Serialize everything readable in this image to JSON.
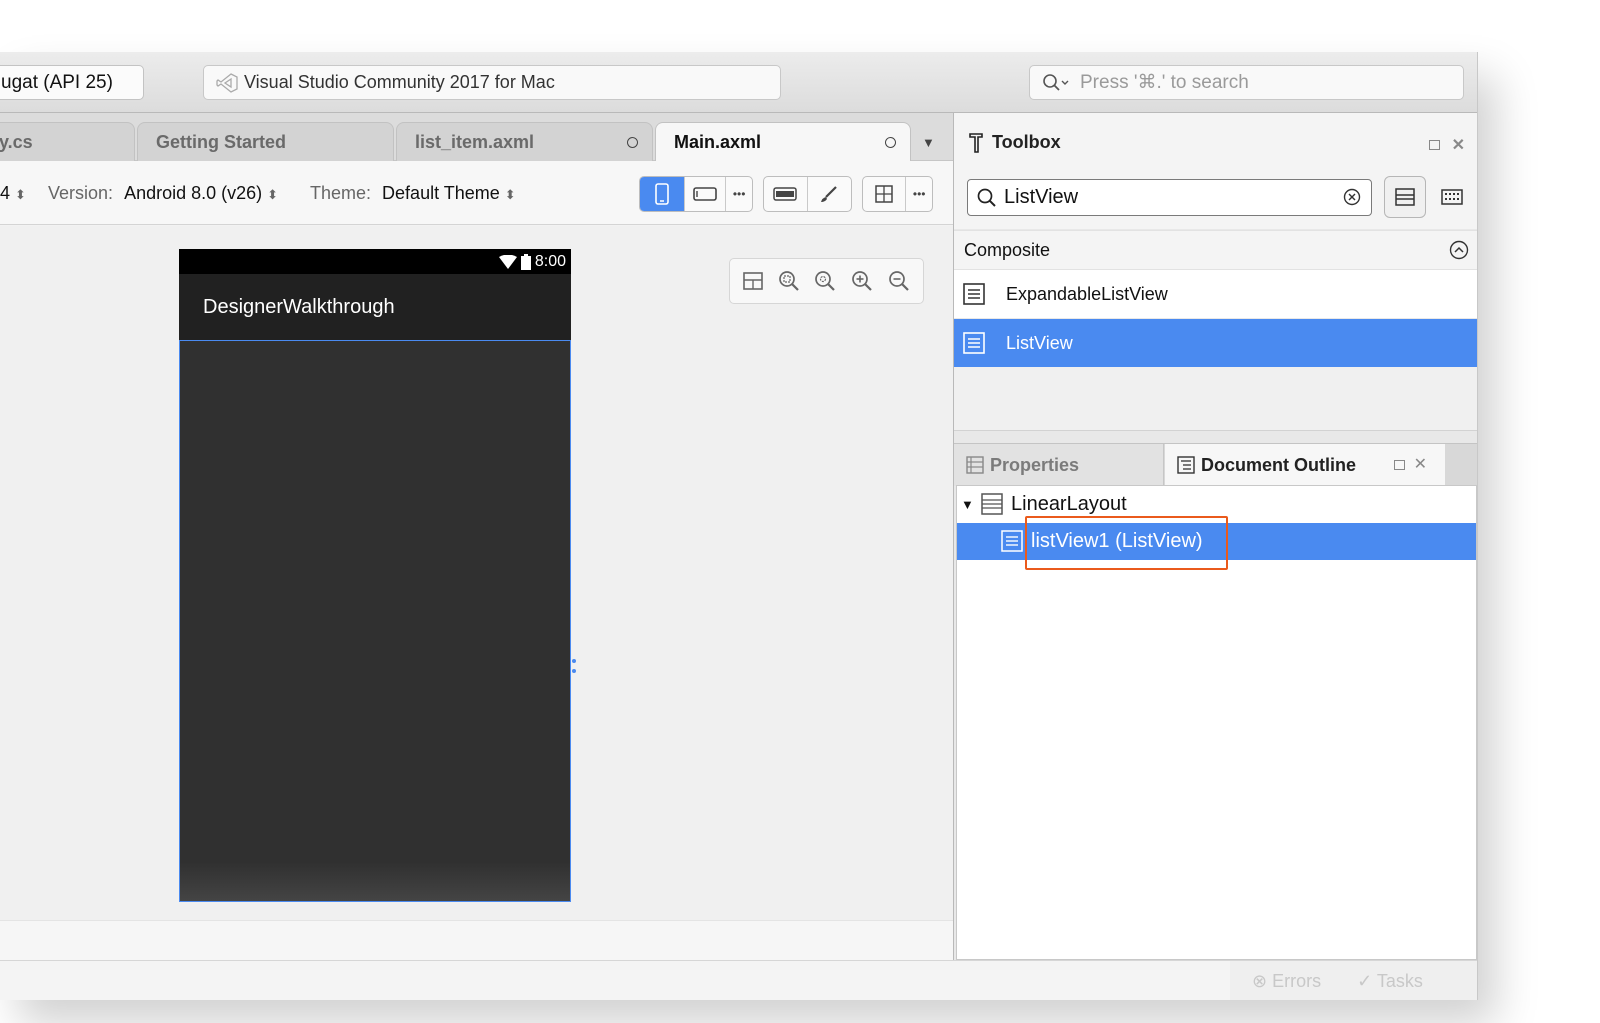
{
  "toolbar": {
    "device": "ugat (API 25)",
    "status_text": "Visual Studio Community 2017 for Mac",
    "search_placeholder": "Press '⌘.' to search"
  },
  "tabs": [
    {
      "label": "y.cs"
    },
    {
      "label": "Getting Started"
    },
    {
      "label": "list_item.axml"
    },
    {
      "label": "Main.axml"
    }
  ],
  "designer_toolbar": {
    "api_value": "4",
    "version_label": "Version:",
    "version_value": "Android 8.0 (v26)",
    "theme_label": "Theme:",
    "theme_value": "Default Theme"
  },
  "phone": {
    "time": "8:00",
    "app_title": "DesignerWalkthrough"
  },
  "toolbox": {
    "title": "Toolbox",
    "search_value": "ListView",
    "category": "Composite",
    "items": [
      "ExpandableListView",
      "ListView"
    ]
  },
  "pane_tabs": {
    "properties": "Properties",
    "outline": "Document Outline"
  },
  "outline": {
    "root": "LinearLayout",
    "child": "listView1 (ListView)"
  },
  "status": {
    "errors": "Errors",
    "tasks": "Tasks"
  },
  "colors": {
    "accent": "#4a8af0",
    "highlight": "#ea5a1c"
  }
}
